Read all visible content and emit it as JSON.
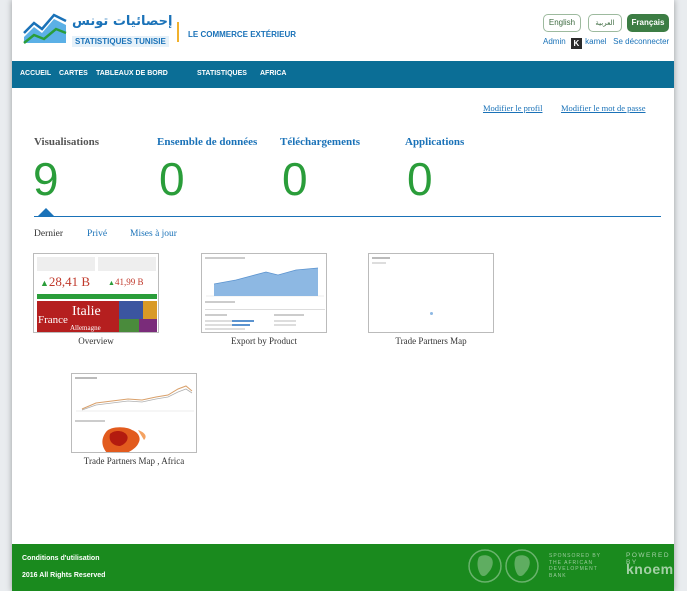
{
  "header": {
    "logo_arabic": "إحصائيات تونس",
    "logo_french": "STATISTIQUES TUNISIE",
    "module_title": "LE COMMERCE EXTÉRIEUR",
    "languages": [
      {
        "label": "English",
        "active": false
      },
      {
        "label": "العربية",
        "active": false
      },
      {
        "label": "Français",
        "active": true
      }
    ],
    "user": {
      "admin_label": "Admin",
      "avatar_letter": "K",
      "username": "kamel",
      "logout_label": "Se déconnecter"
    }
  },
  "nav": {
    "items": [
      "ACCUEIL",
      "CARTES",
      "TABLEAUX DE BORD",
      "STATISTIQUES",
      "AFRICA"
    ]
  },
  "profile": {
    "edit_profile": "Modifier le profil",
    "change_password": "Modifier le mot de passe"
  },
  "stats": [
    {
      "label": "Visualisations",
      "value": "9"
    },
    {
      "label": "Ensemble de données",
      "value": "0"
    },
    {
      "label": "Téléchargements",
      "value": "0"
    },
    {
      "label": "Applications",
      "value": "0"
    }
  ],
  "subtabs": [
    "Dernier",
    "Privé",
    "Mises à jour"
  ],
  "thumbnails": [
    {
      "title": "Overview",
      "big_value": "28,41 B",
      "small_value": "41,99 B",
      "word1": "Italie",
      "word2": "France",
      "word3": "Allemagne"
    },
    {
      "title": "Export by Product"
    },
    {
      "title": "Trade Partners Map"
    },
    {
      "title": "Trade Partners Map , Africa"
    }
  ],
  "footer": {
    "terms": "Conditions d'utilisation",
    "rights": "2016 All Rights Reserved",
    "sponsor_lines": [
      "SPONSORED BY",
      "THE AFRICAN",
      "DEVELOPMENT",
      "BANK"
    ],
    "powered_by": "POWERED BY",
    "brand": "knoema"
  },
  "colors": {
    "nav_bg": "#0b6e96",
    "accent_blue": "#1a72b8",
    "stat_green": "#2a9d3a",
    "footer_green": "#1a8a1e",
    "lang_active": "#3c7d44"
  }
}
